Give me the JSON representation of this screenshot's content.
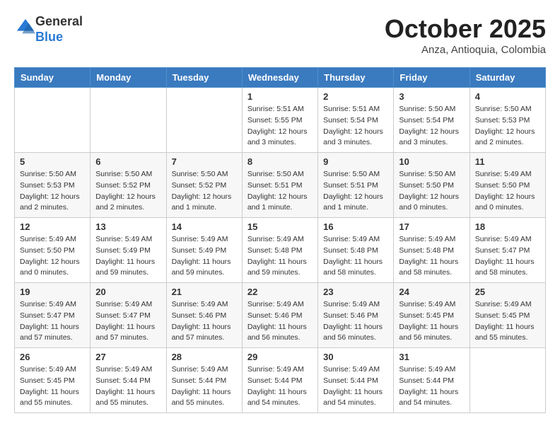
{
  "header": {
    "logo_line1": "General",
    "logo_line2": "Blue",
    "month_title": "October 2025",
    "location": "Anza, Antioquia, Colombia"
  },
  "weekdays": [
    "Sunday",
    "Monday",
    "Tuesday",
    "Wednesday",
    "Thursday",
    "Friday",
    "Saturday"
  ],
  "weeks": [
    [
      {
        "day": "",
        "info": ""
      },
      {
        "day": "",
        "info": ""
      },
      {
        "day": "",
        "info": ""
      },
      {
        "day": "1",
        "info": "Sunrise: 5:51 AM\nSunset: 5:55 PM\nDaylight: 12 hours\nand 3 minutes."
      },
      {
        "day": "2",
        "info": "Sunrise: 5:51 AM\nSunset: 5:54 PM\nDaylight: 12 hours\nand 3 minutes."
      },
      {
        "day": "3",
        "info": "Sunrise: 5:50 AM\nSunset: 5:54 PM\nDaylight: 12 hours\nand 3 minutes."
      },
      {
        "day": "4",
        "info": "Sunrise: 5:50 AM\nSunset: 5:53 PM\nDaylight: 12 hours\nand 2 minutes."
      }
    ],
    [
      {
        "day": "5",
        "info": "Sunrise: 5:50 AM\nSunset: 5:53 PM\nDaylight: 12 hours\nand 2 minutes."
      },
      {
        "day": "6",
        "info": "Sunrise: 5:50 AM\nSunset: 5:52 PM\nDaylight: 12 hours\nand 2 minutes."
      },
      {
        "day": "7",
        "info": "Sunrise: 5:50 AM\nSunset: 5:52 PM\nDaylight: 12 hours\nand 1 minute."
      },
      {
        "day": "8",
        "info": "Sunrise: 5:50 AM\nSunset: 5:51 PM\nDaylight: 12 hours\nand 1 minute."
      },
      {
        "day": "9",
        "info": "Sunrise: 5:50 AM\nSunset: 5:51 PM\nDaylight: 12 hours\nand 1 minute."
      },
      {
        "day": "10",
        "info": "Sunrise: 5:50 AM\nSunset: 5:50 PM\nDaylight: 12 hours\nand 0 minutes."
      },
      {
        "day": "11",
        "info": "Sunrise: 5:49 AM\nSunset: 5:50 PM\nDaylight: 12 hours\nand 0 minutes."
      }
    ],
    [
      {
        "day": "12",
        "info": "Sunrise: 5:49 AM\nSunset: 5:50 PM\nDaylight: 12 hours\nand 0 minutes."
      },
      {
        "day": "13",
        "info": "Sunrise: 5:49 AM\nSunset: 5:49 PM\nDaylight: 11 hours\nand 59 minutes."
      },
      {
        "day": "14",
        "info": "Sunrise: 5:49 AM\nSunset: 5:49 PM\nDaylight: 11 hours\nand 59 minutes."
      },
      {
        "day": "15",
        "info": "Sunrise: 5:49 AM\nSunset: 5:48 PM\nDaylight: 11 hours\nand 59 minutes."
      },
      {
        "day": "16",
        "info": "Sunrise: 5:49 AM\nSunset: 5:48 PM\nDaylight: 11 hours\nand 58 minutes."
      },
      {
        "day": "17",
        "info": "Sunrise: 5:49 AM\nSunset: 5:48 PM\nDaylight: 11 hours\nand 58 minutes."
      },
      {
        "day": "18",
        "info": "Sunrise: 5:49 AM\nSunset: 5:47 PM\nDaylight: 11 hours\nand 58 minutes."
      }
    ],
    [
      {
        "day": "19",
        "info": "Sunrise: 5:49 AM\nSunset: 5:47 PM\nDaylight: 11 hours\nand 57 minutes."
      },
      {
        "day": "20",
        "info": "Sunrise: 5:49 AM\nSunset: 5:47 PM\nDaylight: 11 hours\nand 57 minutes."
      },
      {
        "day": "21",
        "info": "Sunrise: 5:49 AM\nSunset: 5:46 PM\nDaylight: 11 hours\nand 57 minutes."
      },
      {
        "day": "22",
        "info": "Sunrise: 5:49 AM\nSunset: 5:46 PM\nDaylight: 11 hours\nand 56 minutes."
      },
      {
        "day": "23",
        "info": "Sunrise: 5:49 AM\nSunset: 5:46 PM\nDaylight: 11 hours\nand 56 minutes."
      },
      {
        "day": "24",
        "info": "Sunrise: 5:49 AM\nSunset: 5:45 PM\nDaylight: 11 hours\nand 56 minutes."
      },
      {
        "day": "25",
        "info": "Sunrise: 5:49 AM\nSunset: 5:45 PM\nDaylight: 11 hours\nand 55 minutes."
      }
    ],
    [
      {
        "day": "26",
        "info": "Sunrise: 5:49 AM\nSunset: 5:45 PM\nDaylight: 11 hours\nand 55 minutes."
      },
      {
        "day": "27",
        "info": "Sunrise: 5:49 AM\nSunset: 5:44 PM\nDaylight: 11 hours\nand 55 minutes."
      },
      {
        "day": "28",
        "info": "Sunrise: 5:49 AM\nSunset: 5:44 PM\nDaylight: 11 hours\nand 55 minutes."
      },
      {
        "day": "29",
        "info": "Sunrise: 5:49 AM\nSunset: 5:44 PM\nDaylight: 11 hours\nand 54 minutes."
      },
      {
        "day": "30",
        "info": "Sunrise: 5:49 AM\nSunset: 5:44 PM\nDaylight: 11 hours\nand 54 minutes."
      },
      {
        "day": "31",
        "info": "Sunrise: 5:49 AM\nSunset: 5:44 PM\nDaylight: 11 hours\nand 54 minutes."
      },
      {
        "day": "",
        "info": ""
      }
    ]
  ]
}
